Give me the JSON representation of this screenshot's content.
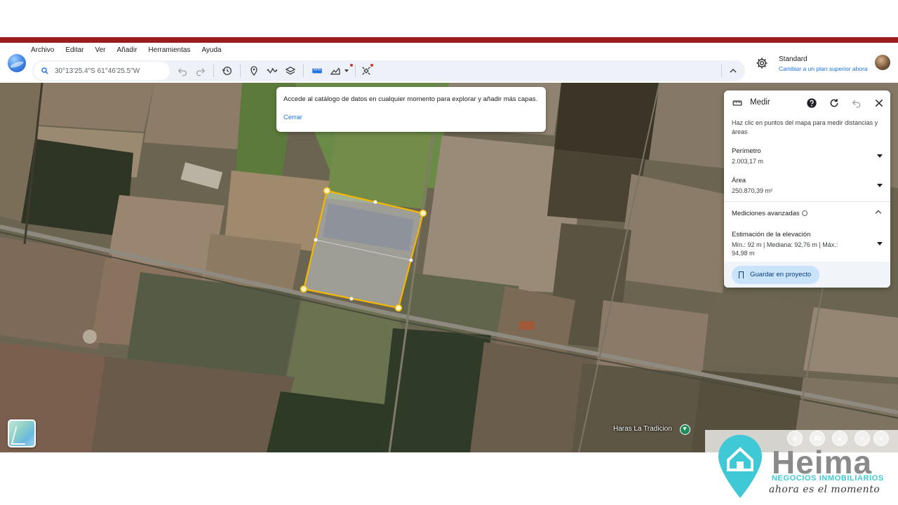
{
  "menu": [
    "Archivo",
    "Editar",
    "Ver",
    "Añadir",
    "Herramientas",
    "Ayuda"
  ],
  "search": {
    "value": "30°13'25.4\"S 61°46'25.5\"W"
  },
  "toolbar_icons": [
    "search-icon",
    "undo-icon",
    "redo-icon",
    "history-icon",
    "pin-icon",
    "path-icon",
    "layers-icon",
    "ruler-icon",
    "chart-icon",
    "satellite-icon",
    "chevron-up-icon"
  ],
  "account": {
    "plan": "Standard",
    "upgrade": "Cambiar a un plan superior ahora"
  },
  "tooltip": {
    "text": "Accede al catálogo de datos en cualquier momento para explorar y añadir más capas.",
    "close": "Cerrar"
  },
  "measure_panel": {
    "title": "Medir",
    "instructions": "Haz clic en puntos del mapa para medir distancias y áreas",
    "perimeter_label": "Perímetro",
    "perimeter_value": "2.003,17 m",
    "area_label": "Área",
    "area_value": "250.870,39 m²",
    "advanced_label": "Mediciones avanzadas",
    "elevation_label": "Estimación de la elevación",
    "elevation_value": "Mín.: 92 m | Mediana: 92,76 m | Máx.: 94,98 m",
    "save_button": "Guardar en proyecto"
  },
  "map": {
    "place_label": "Haras La Tradicion",
    "controls": {
      "three_d": "3D",
      "zoom_out": "−",
      "zoom_in": "+"
    },
    "polygon_color": "#f2b705"
  },
  "watermark": {
    "brand": "Heima",
    "subtitle": "NEGOCIOS INMOBILIARIOS",
    "tagline": "ahora es el momento",
    "accent": "#3fc9d6"
  }
}
